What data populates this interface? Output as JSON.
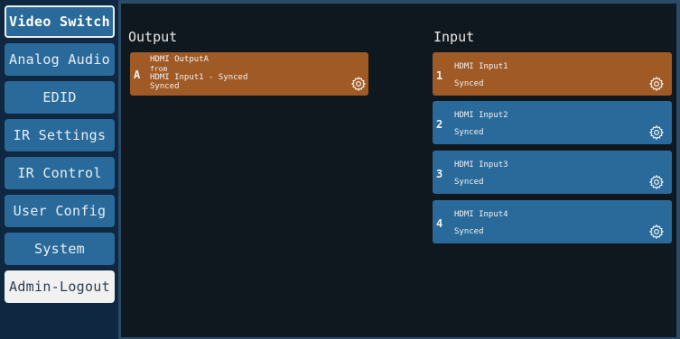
{
  "sidebar": {
    "items": [
      {
        "label": "Video Switch"
      },
      {
        "label": "Analog Audio"
      },
      {
        "label": "EDID"
      },
      {
        "label": "IR Settings"
      },
      {
        "label": "IR Control"
      },
      {
        "label": "User Config"
      },
      {
        "label": "System"
      },
      {
        "label": "Admin-Logout"
      }
    ]
  },
  "output": {
    "title": "Output",
    "cards": [
      {
        "id": "A",
        "name": "HDMI OutputA",
        "from_label": "from",
        "source": "HDMI Input1 - Synced",
        "status": "Synced"
      }
    ]
  },
  "input": {
    "title": "Input",
    "cards": [
      {
        "id": "1",
        "name": "HDMI Input1",
        "status": "Synced",
        "selected": true
      },
      {
        "id": "2",
        "name": "HDMI Input2",
        "status": "Synced",
        "selected": false
      },
      {
        "id": "3",
        "name": "HDMI Input3",
        "status": "Synced",
        "selected": false
      },
      {
        "id": "4",
        "name": "HDMI Input4",
        "status": "Synced",
        "selected": false
      }
    ]
  },
  "icons": {
    "settings": "gear-icon"
  },
  "colors": {
    "selected": "#a05a26",
    "unselected": "#2a6a9a",
    "sidebar": "#0f2740",
    "background": "#10181f"
  }
}
